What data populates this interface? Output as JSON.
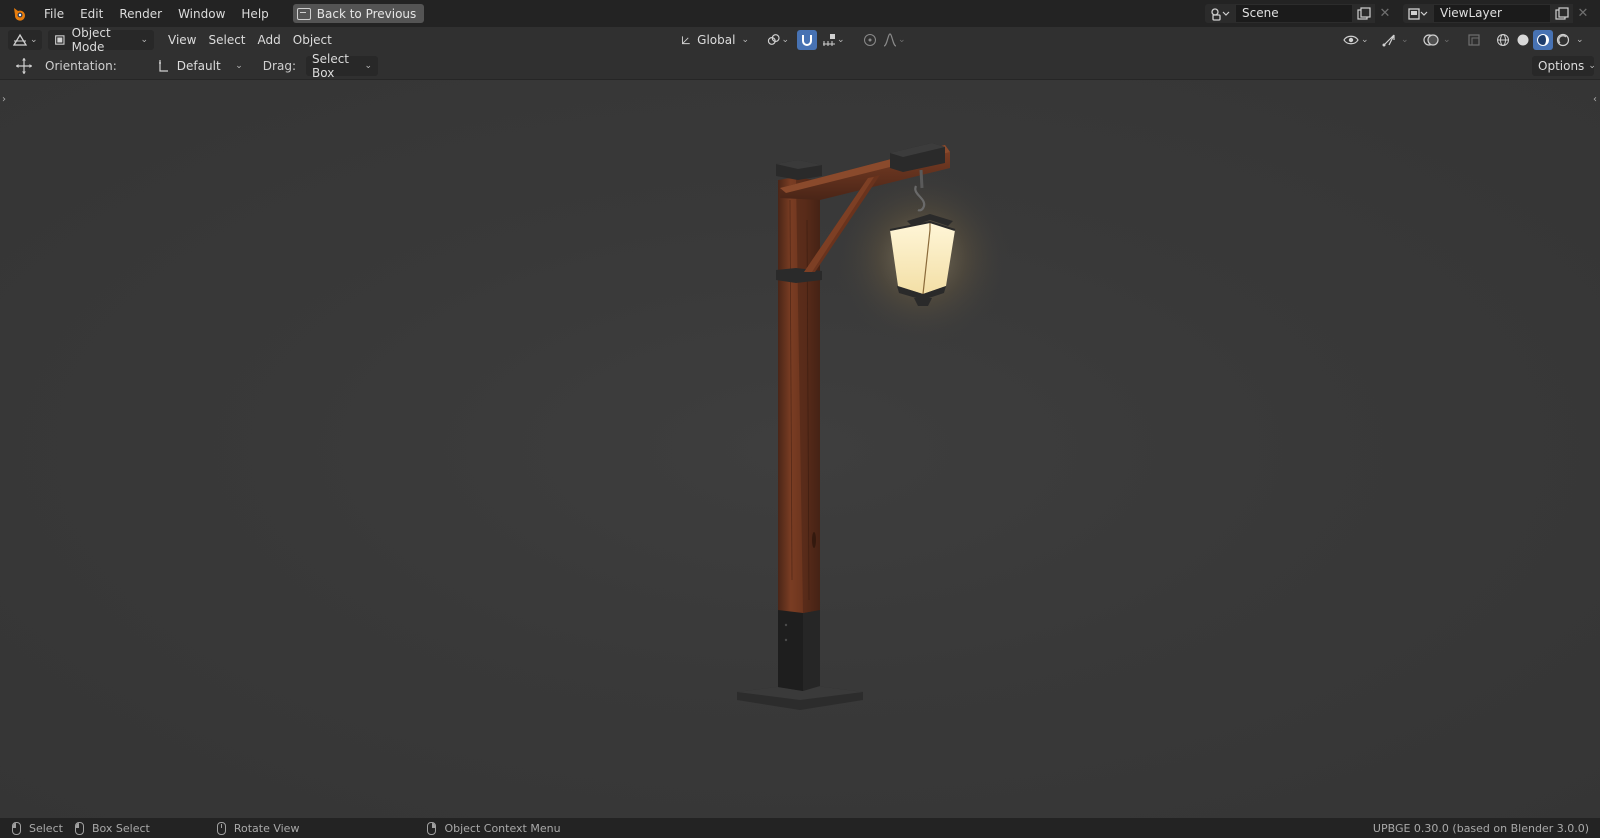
{
  "topbar": {
    "menus": [
      "File",
      "Edit",
      "Render",
      "Window",
      "Help"
    ],
    "back_button": "Back to Previous",
    "scene": "Scene",
    "view_layer": "ViewLayer"
  },
  "header": {
    "mode": "Object Mode",
    "menus": [
      "View",
      "Select",
      "Add",
      "Object"
    ],
    "transform_orientation": "Global"
  },
  "tool_settings": {
    "orientation_label": "Orientation:",
    "orientation_value": "Default",
    "drag_label": "Drag:",
    "drag_value": "Select Box",
    "options": "Options"
  },
  "statusbar": {
    "select": "Select",
    "box_select": "Box Select",
    "rotate_view": "Rotate View",
    "context_menu": "Object Context Menu",
    "version": "UPBGE 0.30.0 (based on Blender 3.0.0)"
  },
  "colors": {
    "accent": "#4772b3",
    "logo": "#e87d0d",
    "lamp_glow": "#fff1c4"
  }
}
